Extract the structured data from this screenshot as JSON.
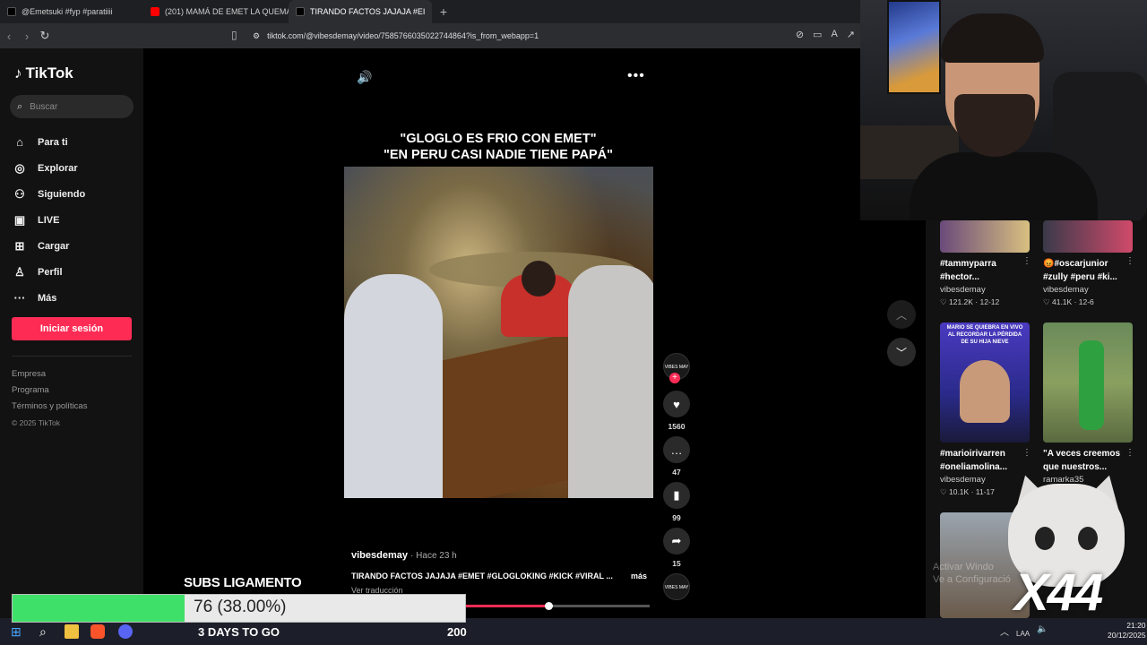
{
  "browser": {
    "tabs": [
      {
        "label": "@Emetsuki #fyp #paratiiii",
        "color": "#111111"
      },
      {
        "label": "(201) MAMÁ DE EMET LA QUEMA EN",
        "color": "#ff0000"
      },
      {
        "label": "TIRANDO FACTOS JAJAJA #EI",
        "color": "#111111"
      }
    ],
    "url": "tiktok.com/@vibesdemay/video/7585766035022744864?is_from_webapp=1"
  },
  "sidebar": {
    "logo": "TikTok",
    "search_placeholder": "Buscar",
    "nav": [
      {
        "label": "Para ti",
        "icon": "home-icon"
      },
      {
        "label": "Explorar",
        "icon": "compass-icon"
      },
      {
        "label": "Siguiendo",
        "icon": "users-icon"
      },
      {
        "label": "LIVE",
        "icon": "live-icon"
      },
      {
        "label": "Cargar",
        "icon": "upload-icon"
      },
      {
        "label": "Perfil",
        "icon": "profile-icon"
      },
      {
        "label": "Más",
        "icon": "more-icon"
      }
    ],
    "login": "Iniciar sesión",
    "links": [
      "Empresa",
      "Programa",
      "Términos y políticas"
    ],
    "copyright": "© 2025 TikTok"
  },
  "video": {
    "caption_line1": "\"GLOGLO ES FRIO CON EMET\"",
    "caption_line2": "\"EN PERU CASI NADIE TIENE PAPÁ\"",
    "author_avatar_text": "VIBES MAY",
    "likes": "1560",
    "comments": "47",
    "saves": "99",
    "shares": "15",
    "username": "vibesdemay",
    "time": "· Hace 23 h",
    "description": "TIRANDO FACTOS JAJAJA #EMET #GLOGLOKING #KICK #VIRAL ...",
    "more": "más",
    "translate": "Ver traducción",
    "progress": 0.45
  },
  "recommendations": [
    {
      "title": "#tammyparra #hector...",
      "author": "vibesdemay",
      "likes": "121.2K",
      "date": "12-12"
    },
    {
      "title": "😡#oscarjunior #zully #peru #ki...",
      "author": "vibesdemay",
      "likes": "41.1K",
      "date": "12-6"
    },
    {
      "title": "#marioirivarren #oneliamolina...",
      "author": "vibesdemay",
      "likes": "10.1K",
      "date": "11-17",
      "thumb_text": "MARIO SE QUIEBRA EN VIVO AL RECORDAR LA PÉRDIDA DE SU HIJA NIEVE"
    },
    {
      "title": "\"A veces creemos que nuestros...",
      "author": "ramarka35",
      "likes": "",
      "date": ""
    }
  ],
  "overlay": {
    "subs_label": "SUBS LIGAMENTO",
    "subs_value": "76 (38.00%)",
    "subs_fraction": 0.38,
    "days": "3 DAYS TO GO",
    "goal": "200",
    "multiplier": "X44",
    "watermark1": "Activar Windo",
    "watermark2": "Ve a Configuració"
  },
  "taskbar": {
    "time": "21:20",
    "date": "20/12/2025",
    "lang": "LAA"
  },
  "colors": {
    "accent": "#fe2c55",
    "progress_green": "#3fe06a"
  }
}
